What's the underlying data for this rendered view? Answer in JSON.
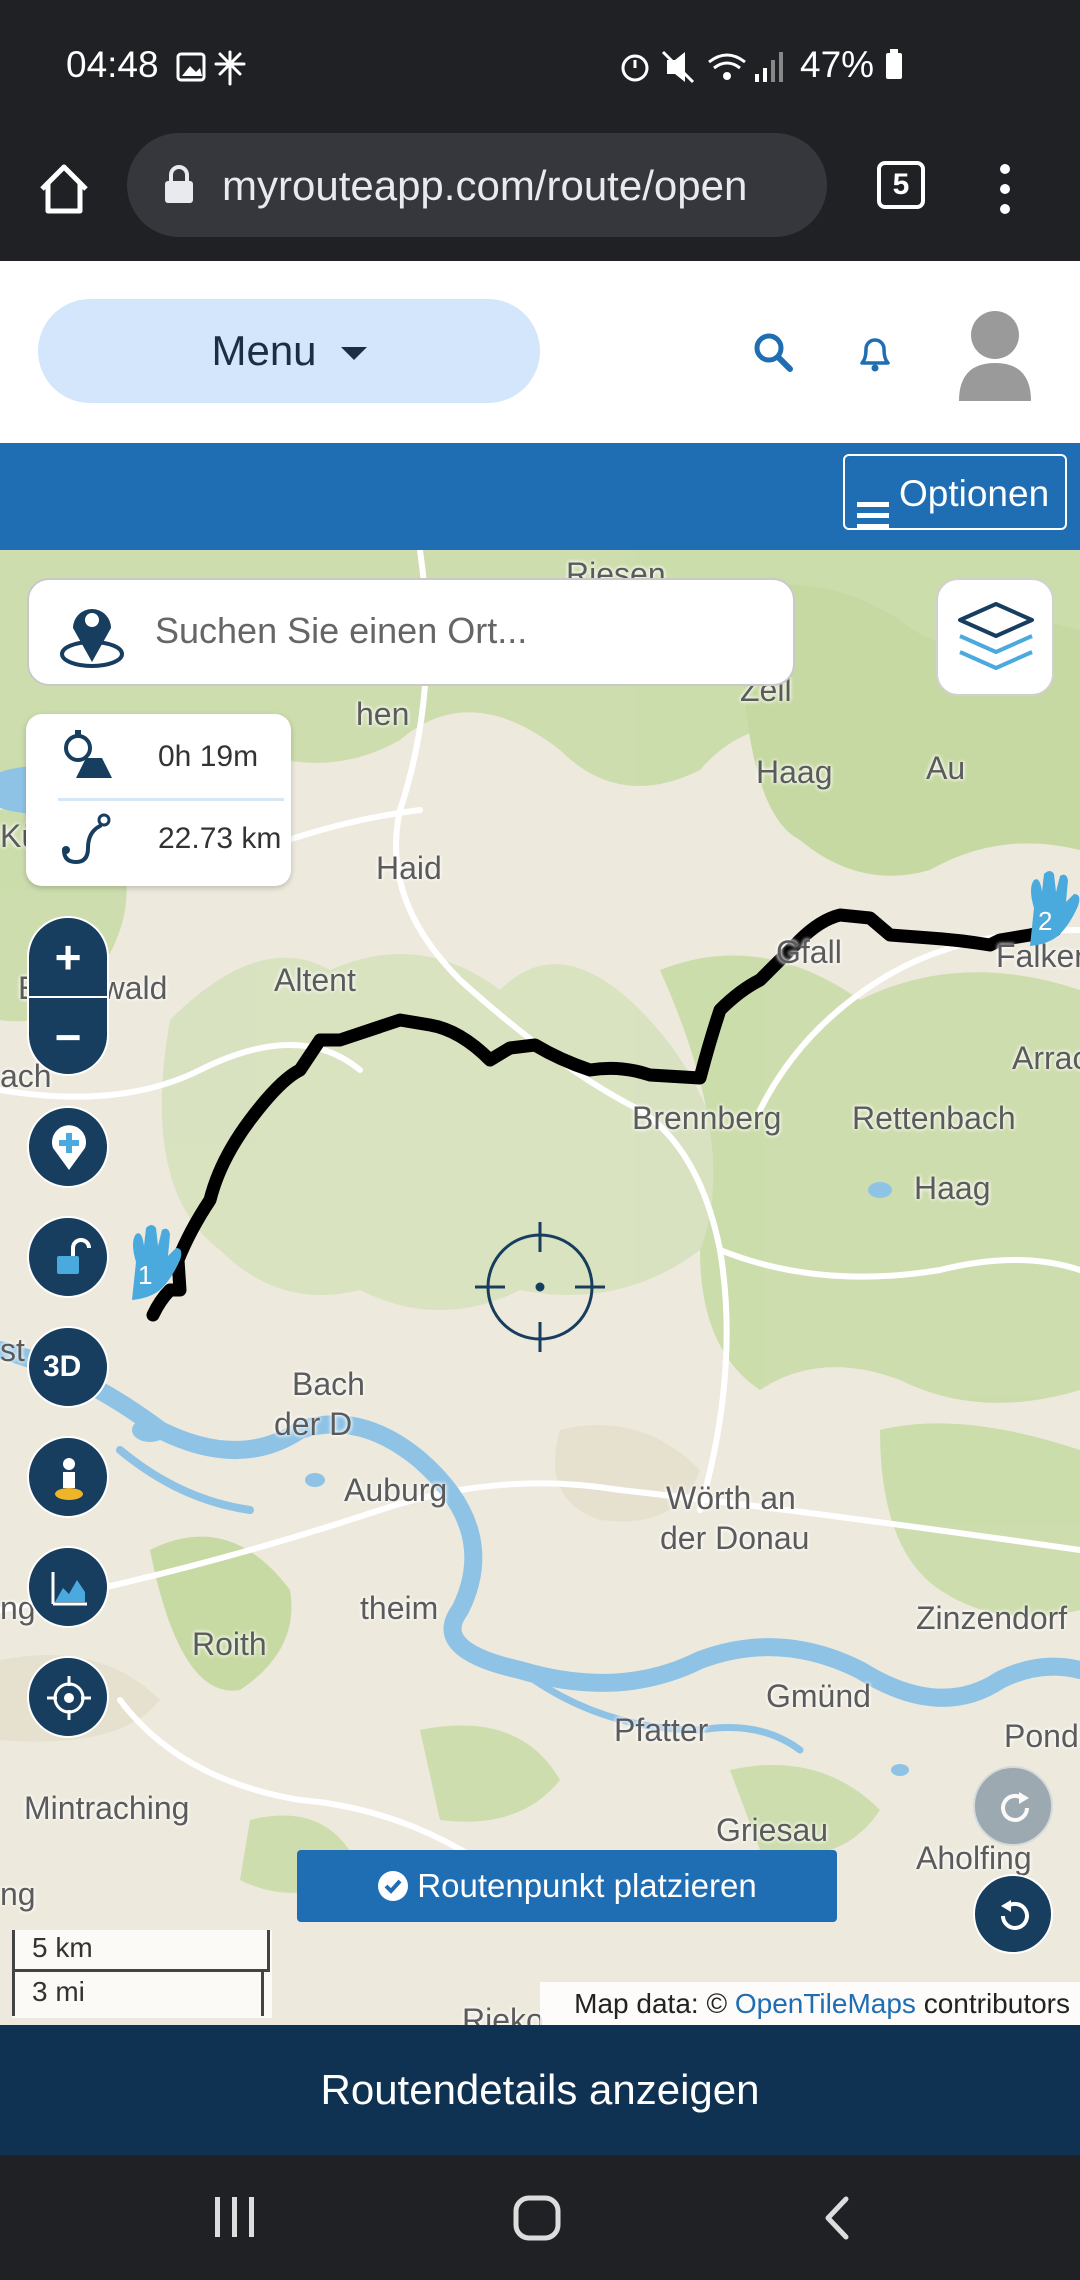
{
  "status_bar": {
    "time": "04:48",
    "battery": "47%"
  },
  "browser": {
    "url": "myrouteapp.com/route/open",
    "tab_count": "5"
  },
  "header": {
    "menu_label": "Menu"
  },
  "toolbar": {
    "options_label": "Optionen"
  },
  "map": {
    "search_placeholder": "Suchen Sie einen Ort...",
    "route_duration": "0h 19m",
    "route_distance": "22.73 km",
    "waypoint_start": "1",
    "waypoint_end": "2",
    "three_d_label": "3D",
    "place_button": "Routenpunkt platzieren",
    "scale_km": "5 km",
    "scale_mi": "3 mi",
    "attribution_prefix": "Map data: ©",
    "attribution_link": "OpenTileMaps",
    "attribution_suffix": "contributors",
    "labels": {
      "riesen": "Riesen",
      "zell": "Zell",
      "hen": "hen",
      "haag1": "Haag",
      "au": "Au",
      "kue": "Kü",
      "haid": "Haid",
      "gfall": "Gfall",
      "falkenstein": "Falkens",
      "eardswald": "Eardswald",
      "altent": "Altent",
      "arrach": "Arrac",
      "ach": "ach",
      "brennberg": "Brennberg",
      "rettenbach": "Rettenbach",
      "haag2": "Haag",
      "st": "st",
      "bach": "Bach",
      "derd": "der D",
      "auburg": "Auburg",
      "woerth1": "Wörth an",
      "woerth2": "der Donau",
      "ng": "ng",
      "theim": "theim",
      "roith": "Roith",
      "zinzendorf": "Zinzendorf",
      "gmuend": "Gmünd",
      "pfatter": "Pfatter",
      "pond": "Pond",
      "mintraching": "Mintraching",
      "griesau": "Griesau",
      "aholfing": "Aholfing",
      "ng2": "ng",
      "rieko": "Rieko"
    }
  },
  "footer": {
    "details_label": "Routendetails anzeigen"
  },
  "colors": {
    "brand_blue": "#1f6db3",
    "dark_navy": "#0f3152",
    "control_navy": "#173d5f",
    "waypoint_blue": "#4aa9dd",
    "route_line": "#000000",
    "river": "#8fc3e6"
  },
  "icons": {
    "home": "home-icon",
    "lock": "lock-icon",
    "more": "more-vert-icon",
    "search": "search-icon",
    "bell": "bell-icon",
    "avatar": "avatar-icon",
    "layers": "layers-icon",
    "pin": "location-pin-icon",
    "crosshair": "crosshair-icon"
  }
}
